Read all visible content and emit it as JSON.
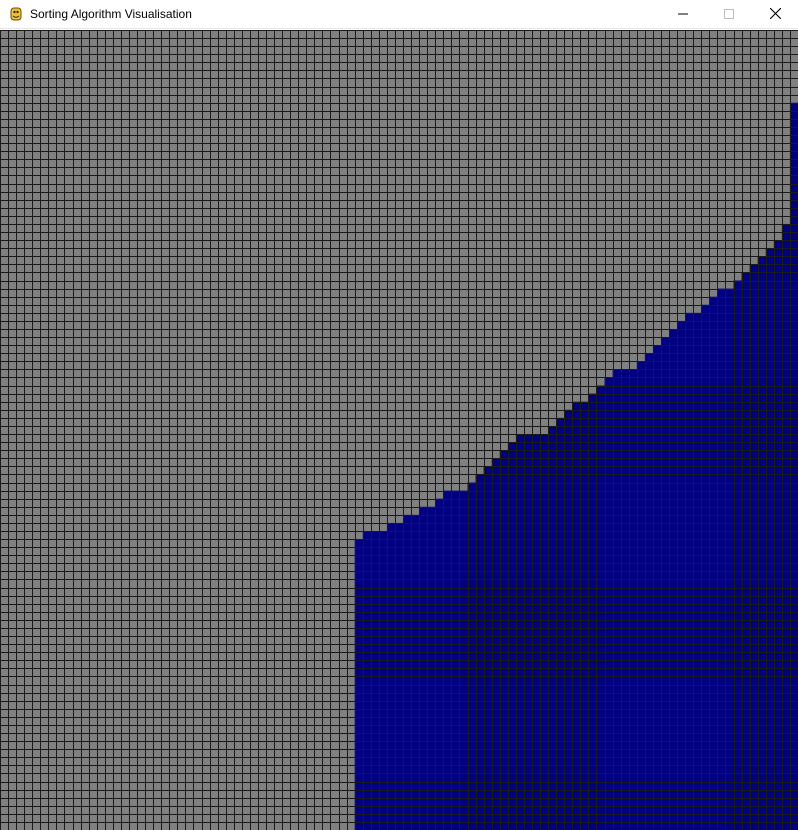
{
  "window": {
    "title": "Sorting Algorithm Visualisation",
    "icon": "pygame-snake-icon",
    "controls": [
      "minimize-icon",
      "maximize-icon",
      "close-icon"
    ]
  },
  "visual": {
    "grid_columns": 99,
    "grid_rows": 99,
    "unsorted_color": "#808080",
    "sorted_color": "#000080",
    "grid_line_color": "#1a1a1a",
    "sorted_column_heights": [
      0,
      0,
      0,
      0,
      0,
      0,
      0,
      0,
      0,
      0,
      0,
      0,
      0,
      0,
      0,
      0,
      0,
      0,
      0,
      0,
      0,
      0,
      0,
      0,
      0,
      0,
      0,
      0,
      0,
      0,
      0,
      0,
      0,
      0,
      0,
      0,
      0,
      0,
      0,
      0,
      0,
      0,
      0,
      0,
      36,
      37,
      37,
      37,
      38,
      38,
      39,
      39,
      40,
      40,
      41,
      42,
      42,
      42,
      43,
      44,
      45,
      46,
      47,
      48,
      49,
      49,
      49,
      49,
      50,
      51,
      52,
      53,
      53,
      54,
      55,
      56,
      57,
      57,
      57,
      58,
      59,
      60,
      61,
      62,
      63,
      64,
      64,
      65,
      66,
      67,
      67,
      68,
      69,
      70,
      71,
      72,
      73,
      75,
      90
    ]
  }
}
